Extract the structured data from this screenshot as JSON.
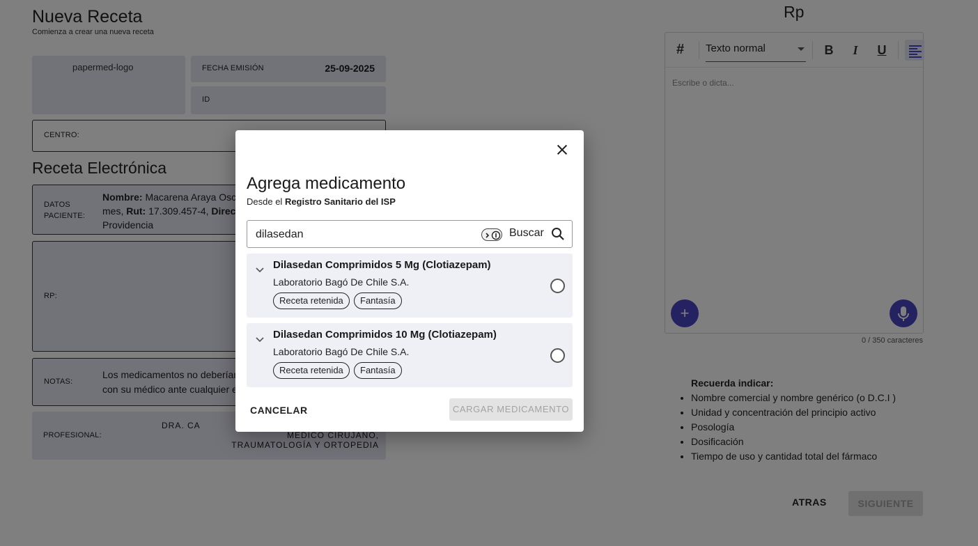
{
  "page": {
    "title": "Nueva Receta",
    "subtitle": "Comienza a crear una nueva receta"
  },
  "header_card": {
    "logo_alt": "papermed-logo",
    "fecha_label": "FECHA EMISIÓN",
    "fecha_value": "25-09-2025",
    "id_label": "ID",
    "centro_label": "CENTRO:"
  },
  "receta": {
    "section_title": "Receta Electrónica",
    "datos_label_line1": "DATOS",
    "datos_label_line2": "PACIENTE:",
    "nombre_label": "Nombre:",
    "nombre_value": "Macarena Araya Osc",
    "line2_prefix": "mes,",
    "rut_label": "Rut:",
    "rut_value": "17.309.457-4,",
    "direccion_label": "Direcc",
    "line3": "Providencia",
    "rp_label": "RP:",
    "notas_label": "NOTAS:",
    "notas_line1": "Los medicamentos no deberían",
    "notas_line2": "con su médico ante cualquier e",
    "profesional_label": "PROFESIONAL:",
    "profesional_line1": "DRA. CA",
    "profesional_line2": "MÉDICO CIRUJANO,",
    "profesional_line3": "TRAUMATOLOGÍA Y ORTOPEDIA"
  },
  "editor": {
    "title": "Rp",
    "heading_icon": "#",
    "format_select": "Texto normal",
    "bold_label": "B",
    "italic_label": "I",
    "underline_label": "U",
    "placeholder": "Escribe o dicta...",
    "add_label": "+",
    "char_count": "0 / 350 caracteres"
  },
  "tips": {
    "title": "Recuerda indicar:",
    "items": [
      "Nombre comercial y nombre genérico (o D.C.I )",
      "Unidad y concentración del principio activo",
      "Posología",
      "Dosificación",
      "Tiempo de uso y cantidad total del fármaco"
    ]
  },
  "nav": {
    "atras": "ATRAS",
    "siguiente": "SIGUIENTE"
  },
  "modal": {
    "title": "Agrega medicamento",
    "subtitle_prefix": "Desde el",
    "subtitle_bold": "Registro Sanitario del ISP",
    "search_value": "dilasedan",
    "search_button": "Buscar",
    "results": [
      {
        "name": "Dilasedan Comprimidos 5 Mg (Clotiazepam)",
        "lab": "Laboratorio Bagó De Chile S.A.",
        "tags": [
          "Receta retenida",
          "Fantasía"
        ]
      },
      {
        "name": "Dilasedan Comprimidos 10 Mg (Clotiazepam)",
        "lab": "Laboratorio Bagó De Chile S.A.",
        "tags": [
          "Receta retenida",
          "Fantasía"
        ]
      }
    ],
    "cancel": "CANCELAR",
    "load": "CARGAR MEDICAMENTO"
  },
  "colors": {
    "accent": "#4a45c4",
    "card_bg": "#e4e4f3",
    "result_bg": "#efeff6",
    "overlay": "rgba(0,0,0,0.5)"
  }
}
